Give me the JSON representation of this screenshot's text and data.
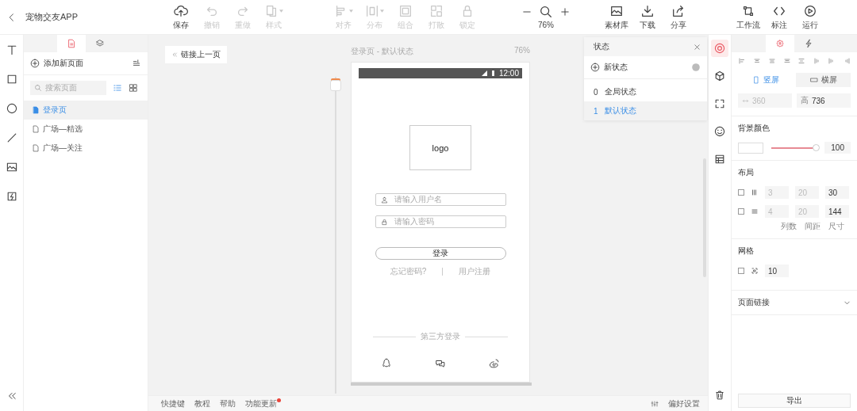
{
  "app": {
    "title": "宠物交友APP"
  },
  "toolbar": [
    {
      "kind": "buttons",
      "items": [
        {
          "label": "保存",
          "disabled": false,
          "menu": false
        },
        {
          "label": "撤销",
          "disabled": true,
          "menu": false
        },
        {
          "label": "重做",
          "disabled": true,
          "menu": false
        },
        {
          "label": "样式",
          "disabled": true,
          "menu": true
        }
      ]
    },
    {
      "kind": "buttons",
      "items": [
        {
          "label": "对齐",
          "disabled": true,
          "menu": true
        },
        {
          "label": "分布",
          "disabled": true,
          "menu": true
        },
        {
          "label": "组合",
          "disabled": true,
          "menu": false
        },
        {
          "label": "打散",
          "disabled": true,
          "menu": false
        },
        {
          "label": "锁定",
          "disabled": true,
          "menu": false
        }
      ]
    },
    {
      "kind": "zoom",
      "value": "76%"
    },
    {
      "kind": "buttons",
      "items": [
        {
          "label": "素材库",
          "disabled": false,
          "menu": false
        },
        {
          "label": "下载",
          "disabled": false,
          "menu": false
        },
        {
          "label": "分享",
          "disabled": false,
          "menu": false
        }
      ]
    },
    {
      "kind": "buttons",
      "items": [
        {
          "label": "工作流",
          "disabled": false,
          "menu": false
        },
        {
          "label": "标注",
          "disabled": false,
          "menu": false
        },
        {
          "label": "运行",
          "disabled": false,
          "menu": false
        }
      ]
    }
  ],
  "pages": {
    "tabs": [
      {
        "selected": true
      },
      {
        "selected": false
      }
    ],
    "add_label": "添加新页面",
    "search_placeholder": "搜索页面",
    "view_modes": [
      {
        "selected": true
      },
      {
        "selected": false
      }
    ],
    "items": [
      {
        "name": "登录页",
        "selected": true
      },
      {
        "name": "广场—精选",
        "selected": false
      },
      {
        "name": "广场—关注",
        "selected": false
      }
    ]
  },
  "canvas": {
    "back_link": "链接上一页",
    "page_title": "登录页 - 默认状态",
    "zoom": "76%"
  },
  "phone": {
    "time": "12:00",
    "logo": "logo",
    "fields": [
      {
        "kind": "user",
        "placeholder": "请输入用户名"
      },
      {
        "kind": "password",
        "placeholder": "请输入密码"
      }
    ],
    "login_button": "登录",
    "links": [
      "忘记密码?",
      "用户注册"
    ],
    "third_party": "第三方登录"
  },
  "states": {
    "title": "状态",
    "new_label": "新状态",
    "items": [
      {
        "index": "0",
        "name": "全局状态",
        "selected": false
      },
      {
        "index": "1",
        "name": "默认状态",
        "selected": true
      }
    ]
  },
  "tool_strip": [
    {
      "selected": true
    },
    {
      "selected": false
    },
    {
      "selected": false
    },
    {
      "selected": false
    },
    {
      "selected": false
    }
  ],
  "inspector": {
    "tabs": [
      {
        "selected": true
      },
      {
        "selected": false
      }
    ],
    "orientation": [
      {
        "label": "竖屏",
        "selected": true
      },
      {
        "label": "横屏",
        "selected": false
      }
    ],
    "width": {
      "value": "360",
      "disabled": true
    },
    "height": {
      "label": "高",
      "value": "736",
      "disabled": false
    },
    "background": {
      "title": "背景颜色",
      "level": 1,
      "opacity": "100"
    },
    "layout": {
      "title": "布局",
      "rows": [
        {
          "checked": false,
          "values": [
            "3",
            "20",
            "30"
          ]
        },
        {
          "checked": false,
          "values": [
            "4",
            "20",
            "144"
          ]
        }
      ],
      "captions": [
        "列数",
        "间距",
        "尺寸"
      ]
    },
    "grid": {
      "title": "网格",
      "checked": false,
      "value": "10"
    },
    "page_link": {
      "title": "页面链接",
      "expanded": false
    },
    "export": "导出"
  },
  "bottom_bar": {
    "links": [
      {
        "label": "快捷键",
        "badge": false
      },
      {
        "label": "教程",
        "badge": false
      },
      {
        "label": "帮助",
        "badge": false
      },
      {
        "label": "功能更新",
        "badge": true
      }
    ],
    "settings": "偏好设置"
  }
}
